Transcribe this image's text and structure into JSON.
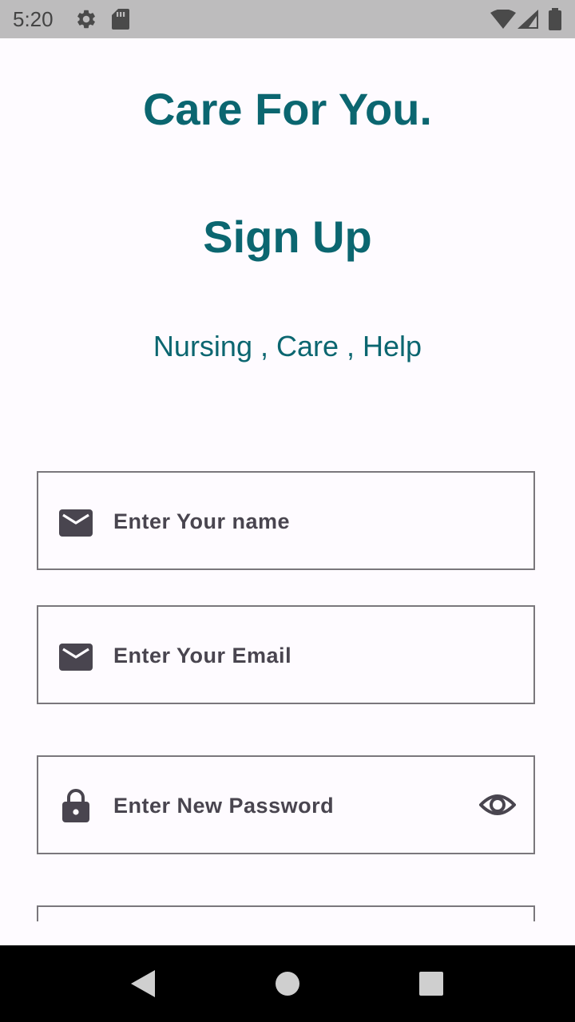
{
  "status_bar": {
    "time": "5:20",
    "icons": [
      "gear-icon",
      "sd-card-icon",
      "wifi-icon",
      "signal-icon",
      "battery-icon"
    ]
  },
  "header": {
    "app_title": "Care For You.",
    "page_title": "Sign Up",
    "tagline": "Nursing , Care , Help"
  },
  "form": {
    "name_field": {
      "placeholder": "Enter Your name",
      "value": "",
      "icon": "mail-icon"
    },
    "email_field": {
      "placeholder": "Enter Your Email",
      "value": "",
      "icon": "mail-icon"
    },
    "password_field": {
      "placeholder": "Enter New Password",
      "value": "",
      "icon": "lock-icon",
      "trailing_icon": "eye-icon"
    }
  },
  "nav": {
    "icons": [
      "back-icon",
      "home-icon",
      "recents-icon"
    ]
  },
  "colors": {
    "accent": "#0b6670",
    "field_text": "#49454f",
    "field_border": "#7a777c",
    "background": "#fefbff",
    "status_bar": "#bdbcbd"
  }
}
